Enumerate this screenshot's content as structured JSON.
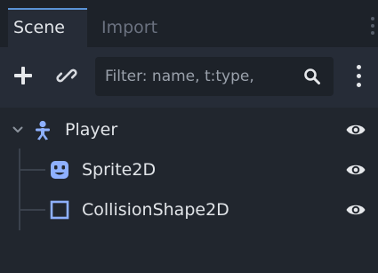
{
  "tabs": [
    {
      "label": "Scene",
      "active": true
    },
    {
      "label": "Import",
      "active": false
    }
  ],
  "toolbar": {
    "add_icon": "plus-icon",
    "link_icon": "link-icon",
    "filter_placeholder": "Filter: name, t:type,",
    "search_icon": "search-icon",
    "menu_icon": "vertical-ellipsis-icon"
  },
  "tree": {
    "nodes": [
      {
        "label": "Player",
        "icon": "character-body-icon",
        "expanded": true,
        "visible": true
      },
      {
        "label": "Sprite2D",
        "icon": "sprite-2d-icon",
        "visible": true
      },
      {
        "label": "CollisionShape2D",
        "icon": "collision-shape-2d-icon",
        "visible": true
      }
    ]
  },
  "colors": {
    "accent": "#5a93d6",
    "character_icon": "#8eb0ff",
    "sprite_icon": "#8eb0ff",
    "collision_icon": "#8eb0ff",
    "text": "#e1e4e8"
  }
}
